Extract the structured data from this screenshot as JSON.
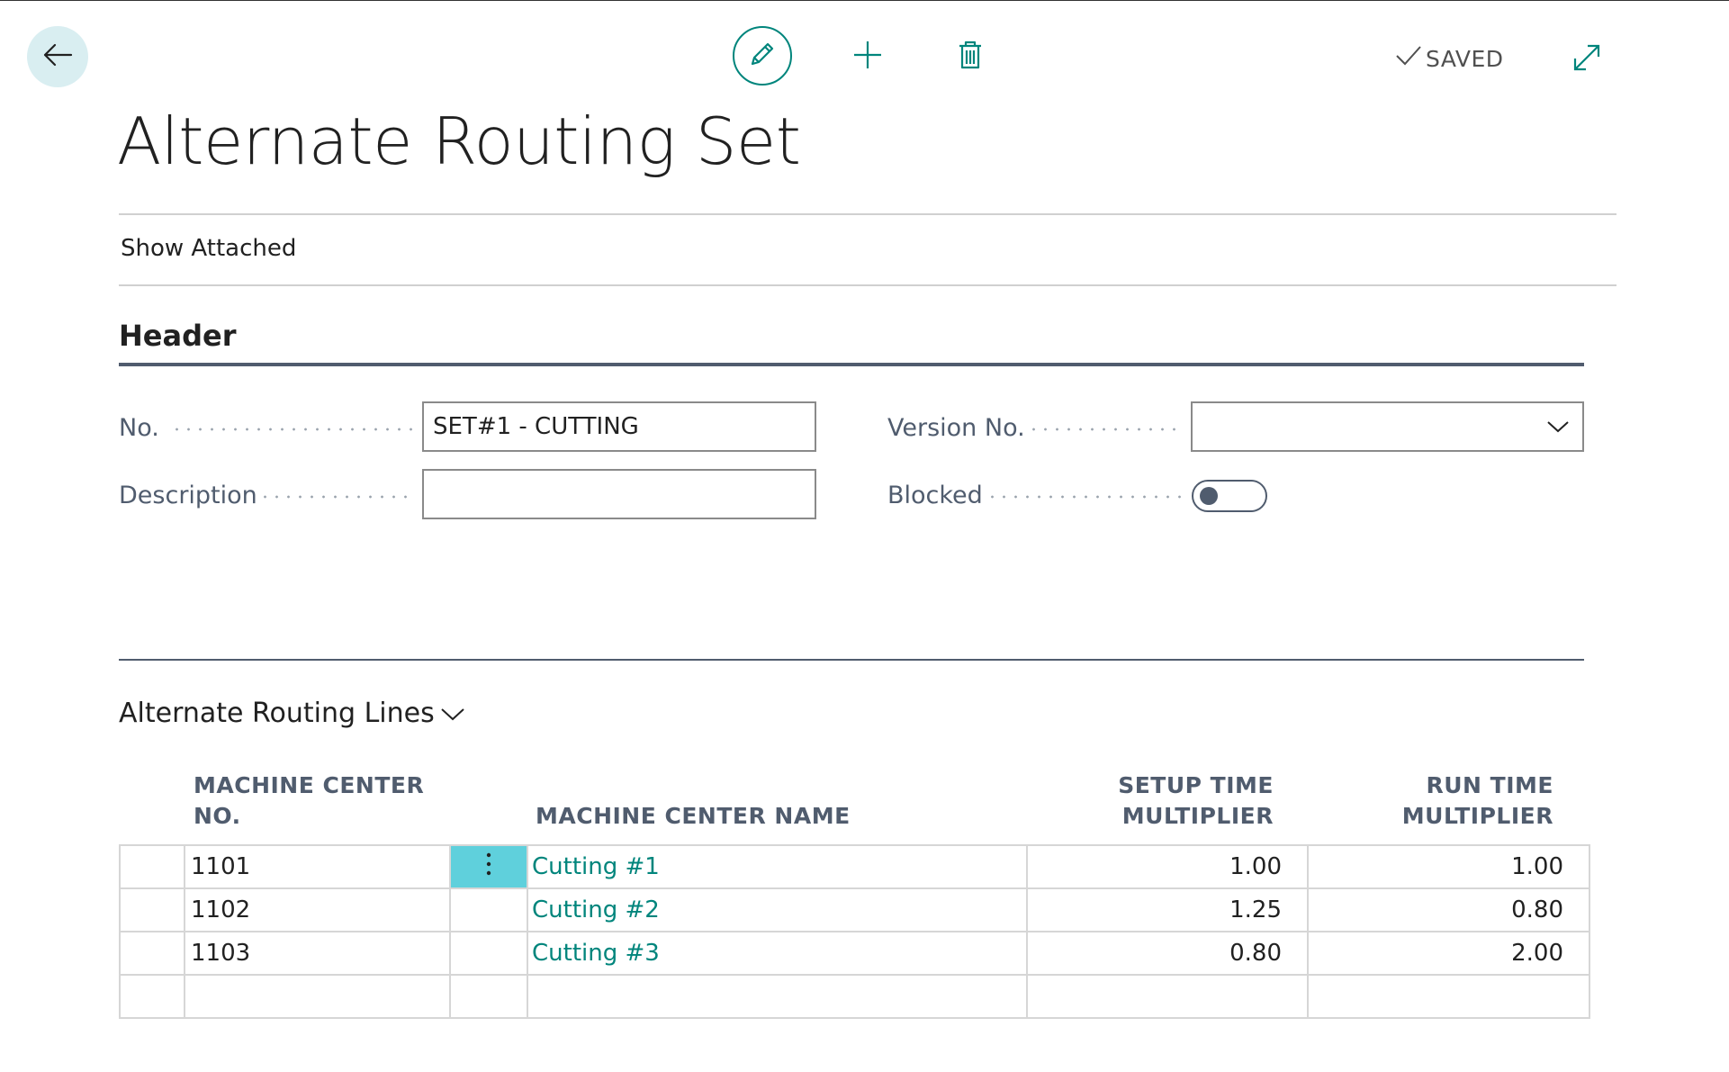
{
  "toolbar": {
    "back_icon": "arrow-left-icon",
    "edit_icon": "pencil-icon",
    "new_icon": "plus-icon",
    "delete_icon": "trash-icon",
    "saved_label": "SAVED",
    "expand_icon": "expand-icon",
    "accent": "#00857c"
  },
  "page": {
    "title": "Alternate Routing Set"
  },
  "actions": {
    "show_attached": "Show Attached"
  },
  "header_section": {
    "title": "Header",
    "fields": {
      "no_label": "No.",
      "no_value": "SET#1 - CUTTING",
      "description_label": "Description",
      "description_value": "",
      "version_label": "Version No.",
      "version_value": "",
      "blocked_label": "Blocked",
      "blocked_value": false
    }
  },
  "lines_section": {
    "title": "Alternate Routing Lines",
    "columns": {
      "machine_center_no_1": "MACHINE CENTER",
      "machine_center_no_2": "NO.",
      "machine_center_name": "MACHINE CENTER NAME",
      "setup_time_1": "SETUP TIME",
      "setup_time_2": "MULTIPLIER",
      "run_time_1": "RUN TIME",
      "run_time_2": "MULTIPLIER"
    },
    "rows": [
      {
        "no": "1101",
        "name": "Cutting #1",
        "setup": "1.00",
        "run": "1.00"
      },
      {
        "no": "1102",
        "name": "Cutting #2",
        "setup": "1.25",
        "run": "0.80"
      },
      {
        "no": "1103",
        "name": "Cutting #3",
        "setup": "0.80",
        "run": "2.00"
      }
    ]
  }
}
